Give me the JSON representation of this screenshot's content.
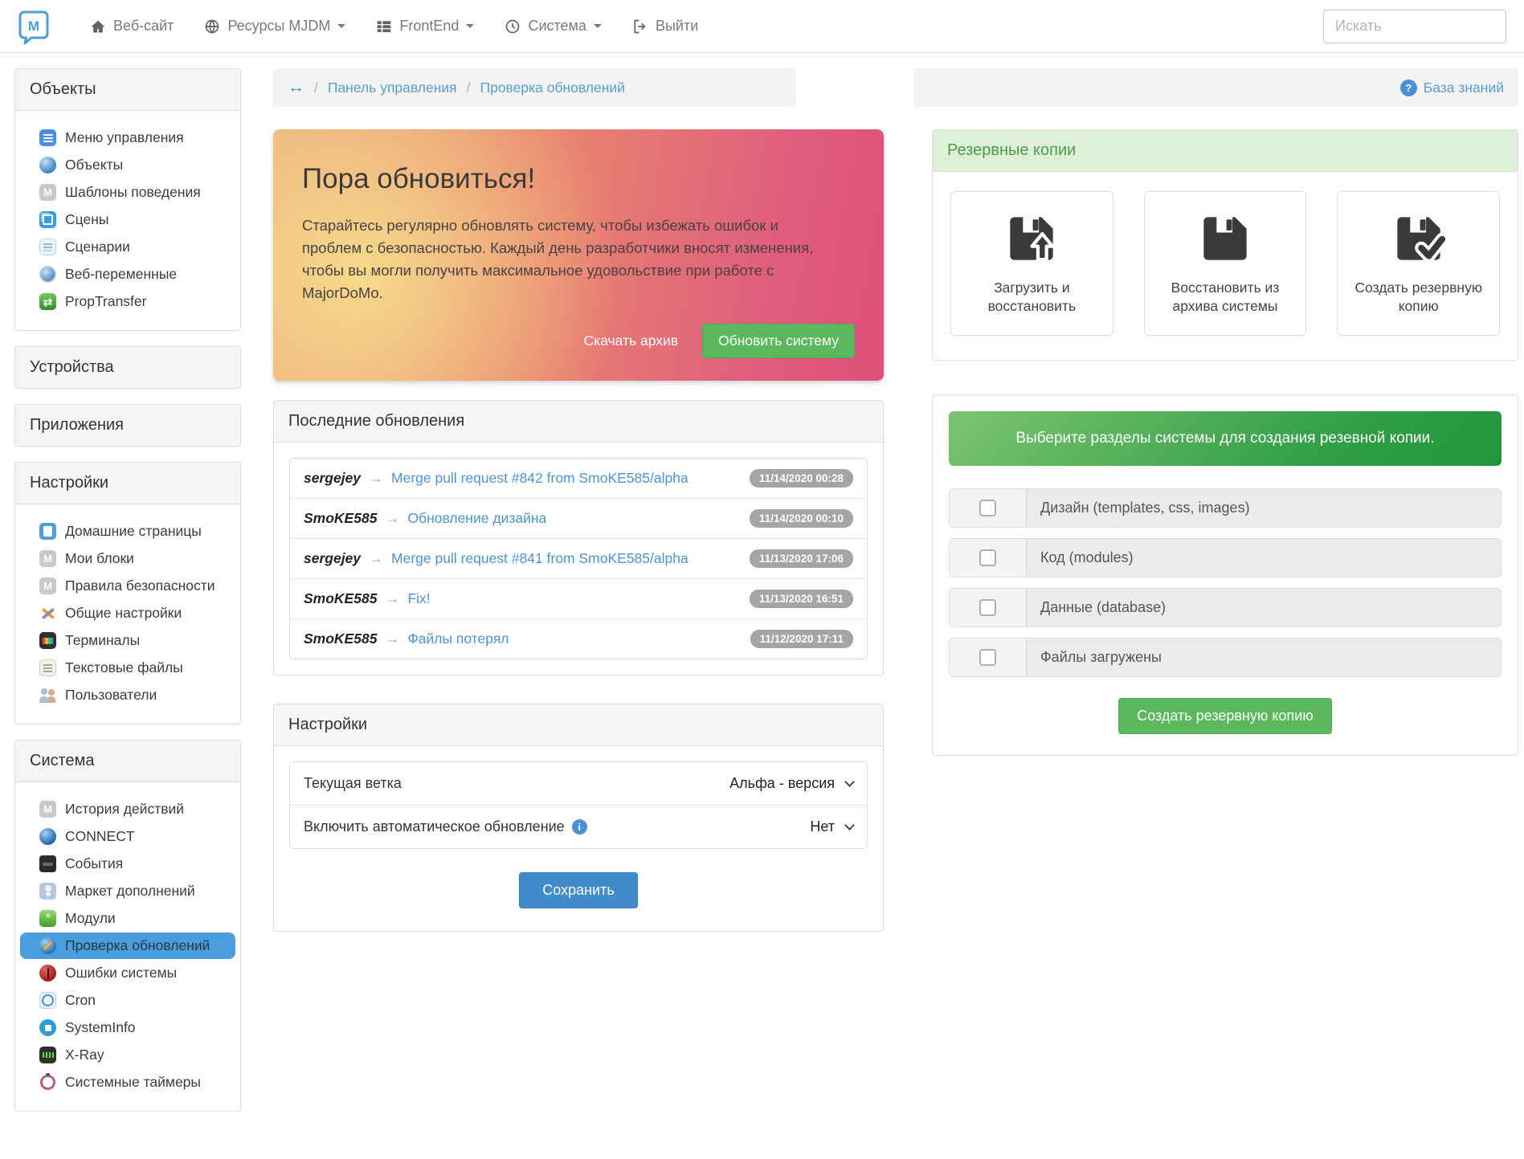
{
  "navbar": {
    "brand": "M",
    "items": [
      {
        "label": "Веб-сайт",
        "icon": "home-icon",
        "dropdown": false
      },
      {
        "label": "Ресурсы MJDM",
        "icon": "globe-icon",
        "dropdown": true
      },
      {
        "label": "FrontEnd",
        "icon": "list-icon",
        "dropdown": true
      },
      {
        "label": "Система",
        "icon": "dashboard-icon",
        "dropdown": true
      },
      {
        "label": "Выйти",
        "icon": "logout-icon",
        "dropdown": false
      }
    ],
    "search_placeholder": "Искать"
  },
  "breadcrumb": {
    "home_icon": "↔",
    "items": [
      "Панель управления",
      "Проверка обновлений"
    ],
    "help_label": "База знаний",
    "help_icon": "?"
  },
  "sidebar": {
    "sections": [
      {
        "title": "Объекты",
        "items": [
          {
            "label": "Меню управления",
            "icon": "control-menu-icon"
          },
          {
            "label": "Объекты",
            "icon": "objects-sphere-icon"
          },
          {
            "label": "Шаблоны поведения",
            "icon": "majordomo-icon"
          },
          {
            "label": "Сцены",
            "icon": "scenes-icon"
          },
          {
            "label": "Сценарии",
            "icon": "scenario-icon"
          },
          {
            "label": "Веб-переменные",
            "icon": "web-variables-icon"
          },
          {
            "label": "PropTransfer",
            "icon": "transfer-icon"
          }
        ]
      },
      {
        "title": "Устройства",
        "items": []
      },
      {
        "title": "Приложения",
        "items": []
      },
      {
        "title": "Настройки",
        "items": [
          {
            "label": "Домашние страницы",
            "icon": "document-icon"
          },
          {
            "label": "Мои блоки",
            "icon": "majordomo-icon"
          },
          {
            "label": "Правила безопасности",
            "icon": "majordomo-icon"
          },
          {
            "label": "Общие настройки",
            "icon": "tools-icon"
          },
          {
            "label": "Терминалы",
            "icon": "monitor-icon"
          },
          {
            "label": "Текстовые файлы",
            "icon": "notes-icon"
          },
          {
            "label": "Пользователи",
            "icon": "users-icon"
          }
        ]
      },
      {
        "title": "Система",
        "items": [
          {
            "label": "История действий",
            "icon": "majordomo-icon"
          },
          {
            "label": "CONNECT",
            "icon": "globe-icon"
          },
          {
            "label": "События",
            "icon": "events-icon"
          },
          {
            "label": "Маркет дополнений",
            "icon": "market-icon"
          },
          {
            "label": "Модули",
            "icon": "puzzle-icon"
          },
          {
            "label": "Проверка обновлений",
            "icon": "update-check-icon",
            "active": true
          },
          {
            "label": "Ошибки системы",
            "icon": "bug-icon"
          },
          {
            "label": "Cron",
            "icon": "cron-clock-icon"
          },
          {
            "label": "SystemInfo",
            "icon": "sysinfo-icon"
          },
          {
            "label": "X-Ray",
            "icon": "xray-icon"
          },
          {
            "label": "Системные таймеры",
            "icon": "timer-icon"
          }
        ]
      }
    ]
  },
  "update_banner": {
    "title": "Пора обновиться!",
    "text": "Старайтесь регулярно обновлять систему, чтобы избежать ошибок и проблем с безопасностью. Каждый день разработчики вносят изменения, чтобы вы могли получить максимальное удовольствие при работе с MajorDoMo.",
    "download_label": "Скачать архив",
    "update_label": "Обновить систему"
  },
  "updates_panel": {
    "title": "Последние обновления",
    "items": [
      {
        "author": "sergejey",
        "arrow": "→",
        "message": "Merge pull request #842 from SmoKE585/alpha",
        "time": "11/14/2020 00:28"
      },
      {
        "author": "SmoKE585",
        "arrow": "→",
        "message": "Обновление дизайна",
        "time": "11/14/2020 00:10"
      },
      {
        "author": "sergejey",
        "arrow": "→",
        "message": "Merge pull request #841 from SmoKE585/alpha",
        "time": "11/13/2020 17:06"
      },
      {
        "author": "SmoKE585",
        "arrow": "→",
        "message": "Fix!",
        "time": "11/13/2020 16:51"
      },
      {
        "author": "SmoKE585",
        "arrow": "→",
        "message": "Файлы потерял",
        "time": "11/12/2020 17:11"
      }
    ]
  },
  "settings_panel": {
    "title": "Настройки",
    "rows": [
      {
        "label": "Текущая ветка",
        "value": "Альфа - версия"
      },
      {
        "label": "Включить автоматическое обновление",
        "value": "Нет",
        "info_icon": "i"
      }
    ],
    "save_label": "Сохранить"
  },
  "backup_panel": {
    "title": "Резервные копии",
    "cards": [
      {
        "label": "Загрузить и восстановить",
        "icon": "floppy-upload-icon"
      },
      {
        "label": "Восстановить из архива системы",
        "icon": "floppy-icon"
      },
      {
        "label": "Создать резервную копию",
        "icon": "floppy-check-icon"
      }
    ]
  },
  "backup_select": {
    "alert": "Выберите разделы системы для создания резевной копии.",
    "options": [
      "Дизайн (templates, css, images)",
      "Код (modules)",
      "Данные (database)",
      "Файлы загружены"
    ],
    "button_label": "Создать резервную копию"
  },
  "colors": {
    "accent_blue": "#428bca",
    "accent_green": "#5cb85c",
    "active_item_bg": "#4a9edd",
    "banner_pink": "#dd4f78",
    "banner_yellow": "#f7de8c",
    "success_bg": "#dff0d8",
    "badge_grey": "#a5a5a5"
  }
}
